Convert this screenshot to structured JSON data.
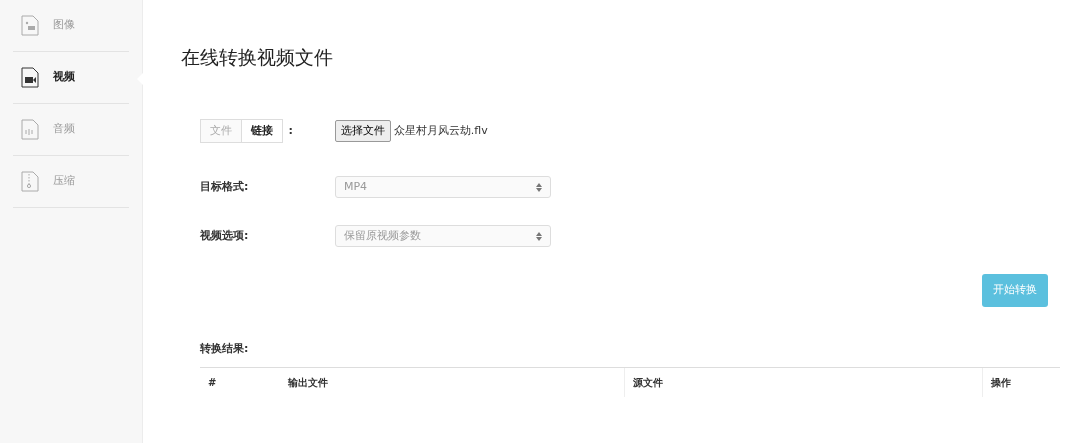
{
  "sidebar": {
    "items": [
      {
        "label": "图像",
        "kind": "image",
        "selected": false
      },
      {
        "label": "视频",
        "kind": "video",
        "selected": true
      },
      {
        "label": "音频",
        "kind": "audio",
        "selected": false
      },
      {
        "label": "压缩",
        "kind": "zip",
        "selected": false
      }
    ]
  },
  "title": "在线转换视频文件",
  "source_tabs": [
    {
      "label": "文件",
      "selected": false
    },
    {
      "label": "链接",
      "selected": true
    }
  ],
  "source_colon": ":",
  "file_button": "选择文件",
  "file_name": "众星村月风云劫.flv",
  "fields": [
    {
      "label": "目标格式:",
      "value": "MP4"
    },
    {
      "label": "视频选项:",
      "value": "保留原视频参数"
    }
  ],
  "convert_button": "开始转换",
  "results_label": "转换结果:",
  "table": {
    "columns": [
      "#",
      "输出文件",
      "源文件",
      "操作"
    ]
  }
}
